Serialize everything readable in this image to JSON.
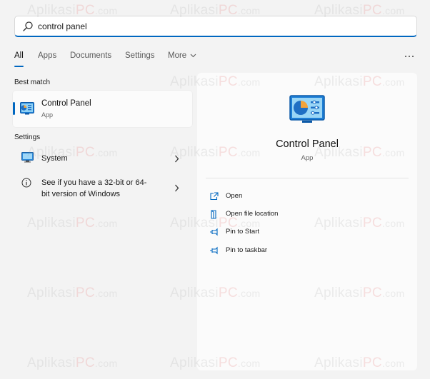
{
  "search": {
    "value": "control panel",
    "placeholder": ""
  },
  "tabs": [
    {
      "label": "All",
      "active": true
    },
    {
      "label": "Apps",
      "active": false
    },
    {
      "label": "Documents",
      "active": false
    },
    {
      "label": "Settings",
      "active": false
    },
    {
      "label": "More",
      "active": false
    }
  ],
  "results": {
    "best_match_header": "Best match",
    "best_match": {
      "title": "Control Panel",
      "type": "App"
    },
    "settings_header": "Settings",
    "settings_items": [
      {
        "label": "System"
      },
      {
        "label_line1": "See if you have a 32-bit or 64-",
        "label_line2": "bit version of Windows"
      }
    ]
  },
  "preview": {
    "title": "Control Panel",
    "type": "App",
    "actions": [
      {
        "label": "Open",
        "icon": "open-icon"
      },
      {
        "label": "Open file location",
        "icon": "file-location-icon"
      },
      {
        "label": "Pin to Start",
        "icon": "pin-icon"
      },
      {
        "label": "Pin to taskbar",
        "icon": "pin-icon"
      }
    ]
  },
  "watermark": {
    "brand": "Aplikasi",
    "accent": "PC",
    "domain": ".com"
  },
  "colors": {
    "accent": "#0067c0",
    "background": "#f3f3f3",
    "panel": "#fbfbfb"
  }
}
